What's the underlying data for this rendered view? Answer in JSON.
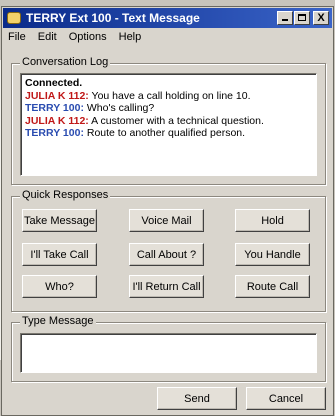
{
  "window": {
    "title": "TERRY Ext 100 - Text Message",
    "close_glyph": "X"
  },
  "menu": [
    "File",
    "Edit",
    "Options",
    "Help"
  ],
  "conversation": {
    "label": "Conversation Log",
    "lines": [
      {
        "speaker": "",
        "text": "Connected.",
        "style": "status"
      },
      {
        "speaker": "JULIA K 112:",
        "text": " You have a call holding on line 10.",
        "style": "red"
      },
      {
        "speaker": "TERRY 100:",
        "text": " Who's calling?",
        "style": "blue"
      },
      {
        "speaker": "JULIA K 112:",
        "text": " A customer with a technical question.",
        "style": "red"
      },
      {
        "speaker": "TERRY 100:",
        "text": " Route to another qualified person.",
        "style": "blue"
      }
    ]
  },
  "quick_responses": {
    "label": "Quick Responses",
    "buttons": [
      [
        "Take Message",
        "Voice Mail",
        "Hold"
      ],
      [
        "I'll Take Call",
        "Call About ?",
        "You Handle"
      ],
      [
        "Who?",
        "I'll Return Call",
        "Route Call"
      ]
    ]
  },
  "type_message": {
    "label": "Type Message",
    "value": ""
  },
  "actions": {
    "send": "Send",
    "cancel": "Cancel"
  },
  "colors": {
    "title_bar": "#0a2a8a",
    "julia_speaker": "#c01818",
    "terry_speaker": "#2a4cb0"
  }
}
